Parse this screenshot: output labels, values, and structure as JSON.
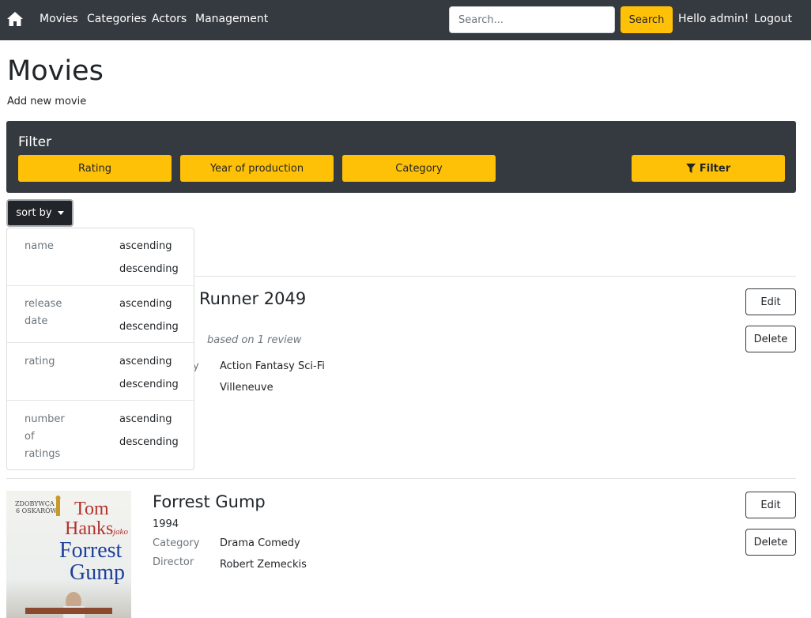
{
  "nav": {
    "links": [
      "Movies",
      "Categories",
      "Actors",
      "Management"
    ],
    "search_placeholder": "Search...",
    "search_button": "Search",
    "greeting": "Hello admin!",
    "logout": "Logout"
  },
  "page": {
    "title": "Movies",
    "add_link": "Add new movie"
  },
  "filter": {
    "title": "Filter",
    "buttons": [
      "Rating",
      "Year of production",
      "Category"
    ],
    "submit": "Filter"
  },
  "sort": {
    "button": "sort by",
    "options": [
      {
        "label": "name",
        "asc": "ascending",
        "desc": "descending"
      },
      {
        "label": "release date",
        "asc": "ascending",
        "desc": "descending"
      },
      {
        "label": "rating",
        "asc": "ascending",
        "desc": "descending"
      },
      {
        "label": "number of ratings",
        "asc": "ascending",
        "desc": "descending"
      }
    ]
  },
  "movies": [
    {
      "title_visible": "Runner 2049",
      "review_note": "based on 1 review",
      "category_label_fragment": "y",
      "category": "Action Fantasy Sci-Fi",
      "director": "Villeneuve",
      "edit": "Edit",
      "delete": "Delete"
    },
    {
      "title": "Forrest Gump",
      "year": "1994",
      "category_label": "Category",
      "category": "Drama Comedy",
      "director_label": "Director",
      "director": "Robert Zemeckis",
      "edit": "Edit",
      "delete": "Delete",
      "poster": {
        "line1": "ZDOBYWCA",
        "line2": "6 OSKARÓW",
        "line3": "Tom",
        "line4": "Hanks",
        "line5": "jako",
        "line6": "Forrest",
        "line7": "Gump"
      }
    }
  ],
  "colors": {
    "navbar": "#343a40",
    "accent": "#ffc107",
    "sort_button": "#212529"
  }
}
